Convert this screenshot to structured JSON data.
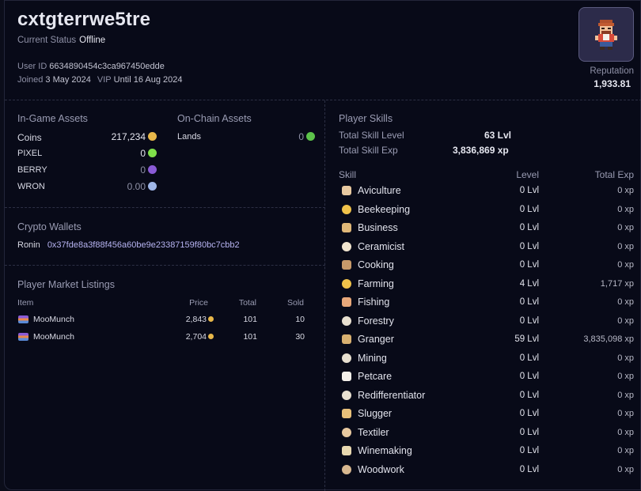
{
  "profile": {
    "username": "cxtgterrwe5tre",
    "status_label": "Current Status",
    "status_value": "Offline",
    "user_id_label": "User ID",
    "user_id": "6634890454c3ca967450edde",
    "joined_label": "Joined",
    "joined": "3 May 2024",
    "vip_label": "VIP",
    "vip": "Until 16 Aug 2024",
    "reputation_label": "Reputation",
    "reputation": "1,933.81"
  },
  "ingame_assets": {
    "title": "In-Game Assets",
    "items": [
      {
        "label": "Coins",
        "value": "217,234",
        "icon": "coin-icon",
        "color": "#e8b84a"
      },
      {
        "label": "PIXEL",
        "value": "0",
        "icon": "gem-icon",
        "color": "#7fe04a"
      },
      {
        "label": "BERRY",
        "value": "0",
        "icon": "berry-icon",
        "color": "#8a5bd6"
      },
      {
        "label": "WRON",
        "value": "0.00",
        "icon": "ronin-icon",
        "color": "#9fb6e8"
      }
    ]
  },
  "onchain_assets": {
    "title": "On-Chain Assets",
    "items": [
      {
        "label": "Lands",
        "value": "0",
        "icon": "tree-icon",
        "color": "#5cc34a"
      }
    ]
  },
  "wallets": {
    "title": "Crypto Wallets",
    "items": [
      {
        "label": "Ronin",
        "address": "0x37fde8a3f88f456a60be9e23387159f80bc7cbb2"
      }
    ]
  },
  "market": {
    "title": "Player Market Listings",
    "headers": {
      "item": "Item",
      "price": "Price",
      "total": "Total",
      "sold": "Sold"
    },
    "rows": [
      {
        "item": "MooMunch",
        "price": "2,843",
        "total": "101",
        "sold": "10"
      },
      {
        "item": "MooMunch",
        "price": "2,704",
        "total": "101",
        "sold": "30"
      }
    ]
  },
  "skills": {
    "title": "Player Skills",
    "total_level_label": "Total Skill Level",
    "total_level": "63 Lvl",
    "total_exp_label": "Total Skill Exp",
    "total_exp": "3,836,869 xp",
    "headers": {
      "skill": "Skill",
      "level": "Level",
      "exp": "Total Exp"
    },
    "rows": [
      {
        "name": "Aviculture",
        "level": "0 Lvl",
        "exp": "0 xp",
        "icon": "bird-icon"
      },
      {
        "name": "Beekeeping",
        "level": "0 Lvl",
        "exp": "0 xp",
        "icon": "bee-icon"
      },
      {
        "name": "Business",
        "level": "0 Lvl",
        "exp": "0 xp",
        "icon": "briefcase-icon"
      },
      {
        "name": "Ceramicist",
        "level": "0 Lvl",
        "exp": "0 xp",
        "icon": "pot-icon"
      },
      {
        "name": "Cooking",
        "level": "0 Lvl",
        "exp": "0 xp",
        "icon": "pan-icon"
      },
      {
        "name": "Farming",
        "level": "4 Lvl",
        "exp": "1,717 xp",
        "icon": "crop-icon"
      },
      {
        "name": "Fishing",
        "level": "0 Lvl",
        "exp": "0 xp",
        "icon": "fish-icon"
      },
      {
        "name": "Forestry",
        "level": "0 Lvl",
        "exp": "0 xp",
        "icon": "mushroom-icon"
      },
      {
        "name": "Granger",
        "level": "59 Lvl",
        "exp": "3,835,098 xp",
        "icon": "wheat-icon"
      },
      {
        "name": "Mining",
        "level": "0 Lvl",
        "exp": "0 xp",
        "icon": "pickaxe-icon"
      },
      {
        "name": "Petcare",
        "level": "0 Lvl",
        "exp": "0 xp",
        "icon": "paw-icon"
      },
      {
        "name": "Redifferentiator",
        "level": "0 Lvl",
        "exp": "0 xp",
        "icon": "recycle-icon"
      },
      {
        "name": "Slugger",
        "level": "0 Lvl",
        "exp": "0 xp",
        "icon": "snail-icon"
      },
      {
        "name": "Textiler",
        "level": "0 Lvl",
        "exp": "0 xp",
        "icon": "tent-icon"
      },
      {
        "name": "Winemaking",
        "level": "0 Lvl",
        "exp": "0 xp",
        "icon": "bottle-icon"
      },
      {
        "name": "Woodwork",
        "level": "0 Lvl",
        "exp": "0 xp",
        "icon": "chair-icon"
      }
    ]
  }
}
